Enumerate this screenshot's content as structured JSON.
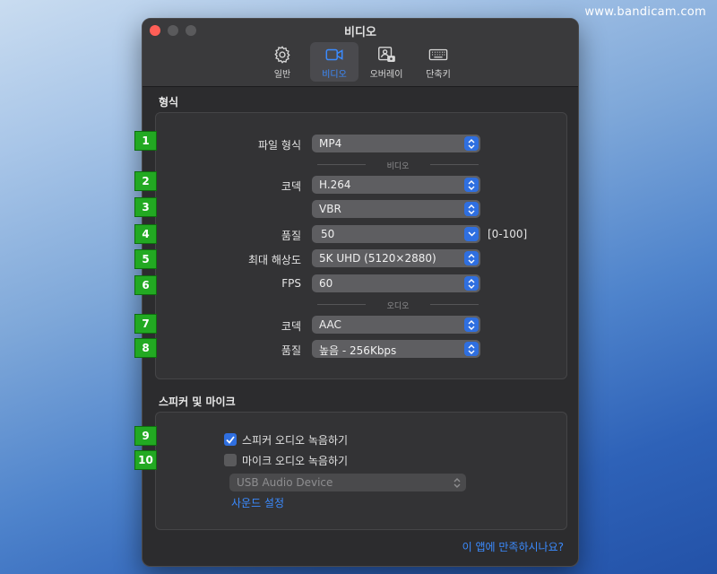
{
  "watermark": "www.bandicam.com",
  "window": {
    "title": "비디오"
  },
  "toolbar": {
    "items": [
      {
        "label": "일반",
        "icon": "gear-icon"
      },
      {
        "label": "비디오",
        "icon": "video-camera-icon",
        "active": true
      },
      {
        "label": "오버레이",
        "icon": "overlay-icon"
      },
      {
        "label": "단축키",
        "icon": "keyboard-icon"
      }
    ]
  },
  "format": {
    "section_title": "형식",
    "file_format_label": "파일 형식",
    "file_format_value": "MP4",
    "video_divider": "비디오",
    "codec_label": "코덱",
    "codec_value": "H.264",
    "bitrate_mode_value": "VBR",
    "quality_label": "품질",
    "quality_value": "50",
    "quality_range": "[0-100]",
    "max_resolution_label": "최대 해상도",
    "max_resolution_value": "5K UHD (5120×2880)",
    "fps_label": "FPS",
    "fps_value": "60",
    "audio_divider": "오디오",
    "audio_codec_label": "코덱",
    "audio_codec_value": "AAC",
    "audio_quality_label": "품질",
    "audio_quality_value": "높음 - 256Kbps"
  },
  "speaker_mic": {
    "section_title": "스피커 및 마이크",
    "record_speaker_label": "스피커 오디오 녹음하기",
    "record_speaker_checked": true,
    "record_mic_label": "마이크 오디오 녹음하기",
    "record_mic_checked": false,
    "mic_device_value": "USB Audio Device",
    "sound_settings_link": "사운드 설정"
  },
  "footer": {
    "feedback_link": "이 앱에 만족하시나요?"
  },
  "badges": [
    "1",
    "2",
    "3",
    "4",
    "5",
    "6",
    "7",
    "8",
    "9",
    "10"
  ],
  "colors": {
    "accent": "#3b8bff",
    "window_bg": "#2c2c2e",
    "badge_green": "#22a922"
  }
}
